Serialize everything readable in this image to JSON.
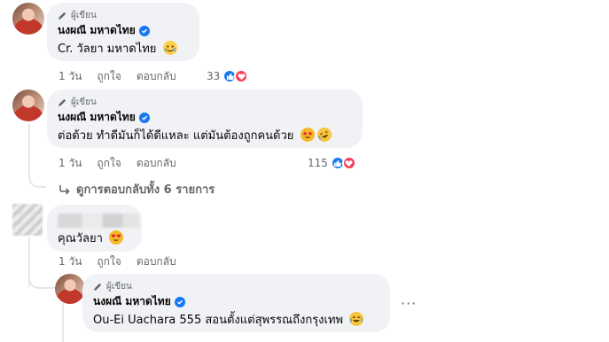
{
  "comments": [
    {
      "author_tag": "ผู้เขียน",
      "name": "นงผณี มหาดไทย",
      "text": "Cr. วัลยา มหาดไทย",
      "emoji": "crying-laughing",
      "meta": {
        "time": "1 วัน",
        "like": "ถูกใจ",
        "reply": "ตอบกลับ"
      },
      "reaction_count": "33"
    },
    {
      "author_tag": "ผู้เขียน",
      "name": "นงผณี มหาดไทย",
      "text": "ต่อด้วย ทำดีมันก็ได้ดีแหละ แต่มันต้องถูกคนด้วย",
      "emoji": "star-struck, rolling-laughing",
      "meta": {
        "time": "1 วัน",
        "like": "ถูกใจ",
        "reply": "ตอบกลับ"
      },
      "reaction_count": "115",
      "view_replies": "ดูการตอบกลับทั้ง 6 รายการ"
    },
    {
      "text": "คุณวัลยา",
      "emoji": "heart-eyes",
      "meta": {
        "time": "1 วัน",
        "like": "ถูกใจ",
        "reply": "ตอบกลับ"
      }
    },
    {
      "author_tag": "ผู้เขียน",
      "name": "นงผณี มหาดไทย",
      "text": "Ou-Ei Uachara 555 สอนตั้งแต่สุพรรณถึงกรุงเทพ",
      "emoji": "tears-of-joy",
      "more": "···"
    }
  ],
  "colors": {
    "bubble": "#f0f2f5",
    "meta": "#65676b",
    "like": "#1877f2",
    "love": "#f33e58",
    "verified": "#1877f2"
  }
}
